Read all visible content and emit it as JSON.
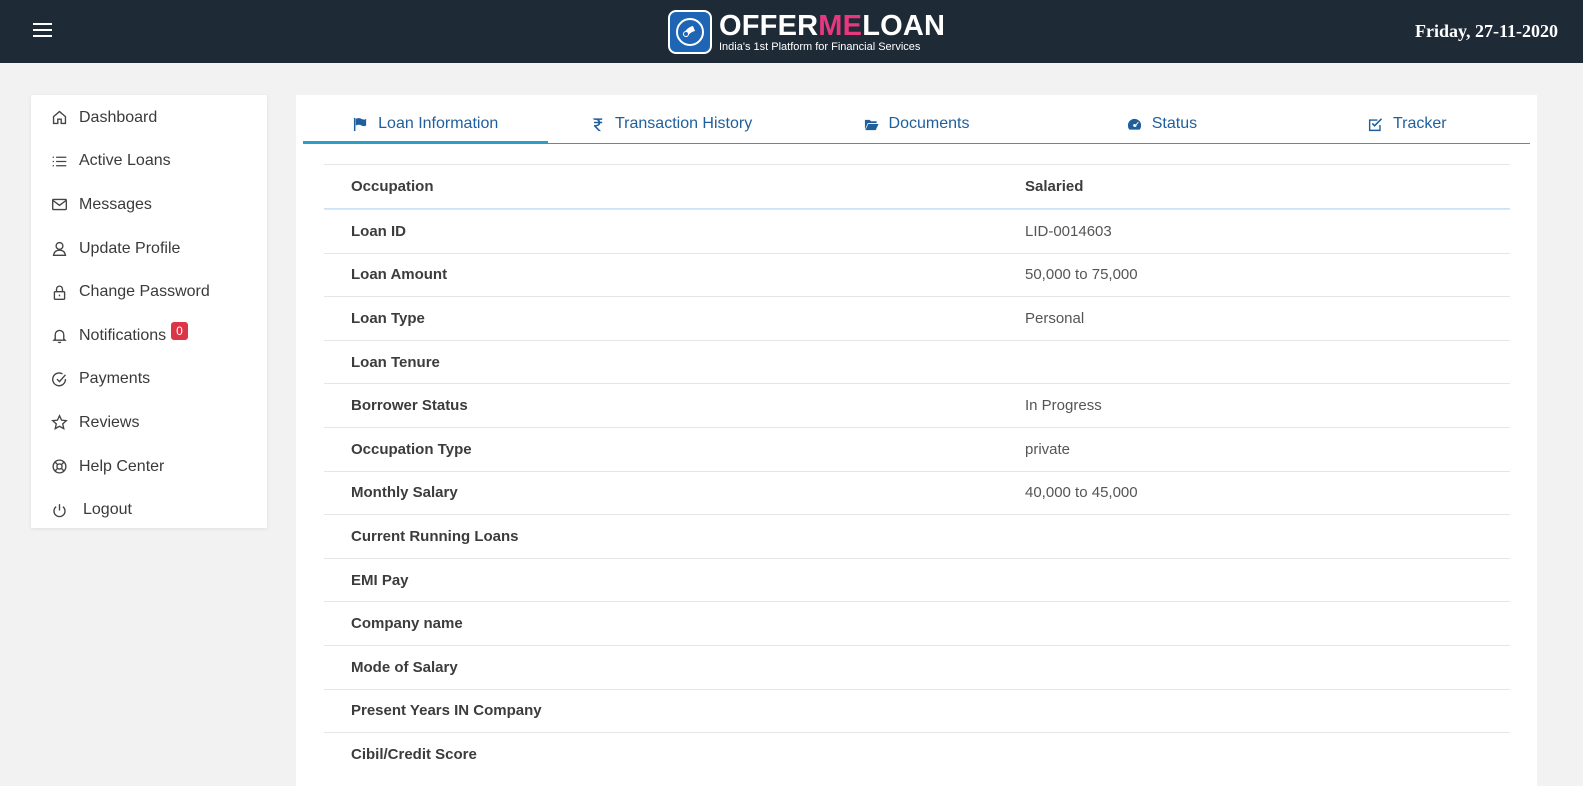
{
  "header": {
    "logo_offer": "OFFER",
    "logo_me": "ME",
    "logo_loan": "LOAN",
    "logo_tagline": "India's 1st Platform for Financial Services",
    "date": "Friday, 27-11-2020"
  },
  "sidebar": {
    "items": [
      {
        "label": "Dashboard",
        "icon": "home-icon"
      },
      {
        "label": "Active Loans",
        "icon": "list-icon"
      },
      {
        "label": "Messages",
        "icon": "mail-icon"
      },
      {
        "label": "Update Profile",
        "icon": "user-icon"
      },
      {
        "label": "Change Password",
        "icon": "lock-icon"
      },
      {
        "label": "Notifications",
        "icon": "bell-icon",
        "badge": "0"
      },
      {
        "label": "Payments",
        "icon": "check-circle-icon"
      },
      {
        "label": "Reviews",
        "icon": "star-icon"
      },
      {
        "label": "Help Center",
        "icon": "lifebuoy-icon"
      },
      {
        "label": "Logout",
        "icon": "power-icon"
      }
    ]
  },
  "tabs": [
    {
      "label": "Loan Information",
      "icon": "flag-icon",
      "active": true
    },
    {
      "label": "Transaction History",
      "icon": "rupee-icon",
      "active": false
    },
    {
      "label": "Documents",
      "icon": "folder-open-icon",
      "active": false
    },
    {
      "label": "Status",
      "icon": "tachometer-icon",
      "active": false
    },
    {
      "label": "Tracker",
      "icon": "check-square-icon",
      "active": false
    }
  ],
  "details": [
    {
      "label": "Occupation",
      "value": "Salaried"
    },
    {
      "label": "Loan ID",
      "value": "LID-0014603"
    },
    {
      "label": "Loan Amount",
      "value": "50,000 to 75,000"
    },
    {
      "label": "Loan Type",
      "value": "Personal"
    },
    {
      "label": "Loan Tenure",
      "value": ""
    },
    {
      "label": "Borrower Status",
      "value": "In Progress"
    },
    {
      "label": "Occupation Type",
      "value": "private"
    },
    {
      "label": "Monthly Salary",
      "value": "40,000 to 45,000"
    },
    {
      "label": "Current Running Loans",
      "value": ""
    },
    {
      "label": "EMI Pay",
      "value": ""
    },
    {
      "label": "Company name",
      "value": ""
    },
    {
      "label": "Mode of Salary",
      "value": ""
    },
    {
      "label": "Present Years IN Company",
      "value": ""
    },
    {
      "label": "Cibil/Credit Score",
      "value": ""
    }
  ],
  "colors": {
    "header_bg": "#1f2a37",
    "accent": "#2aa0c8",
    "tab_text": "#1f5f9c",
    "brand_pink": "#e8377f",
    "badge_red": "#dc3545"
  }
}
